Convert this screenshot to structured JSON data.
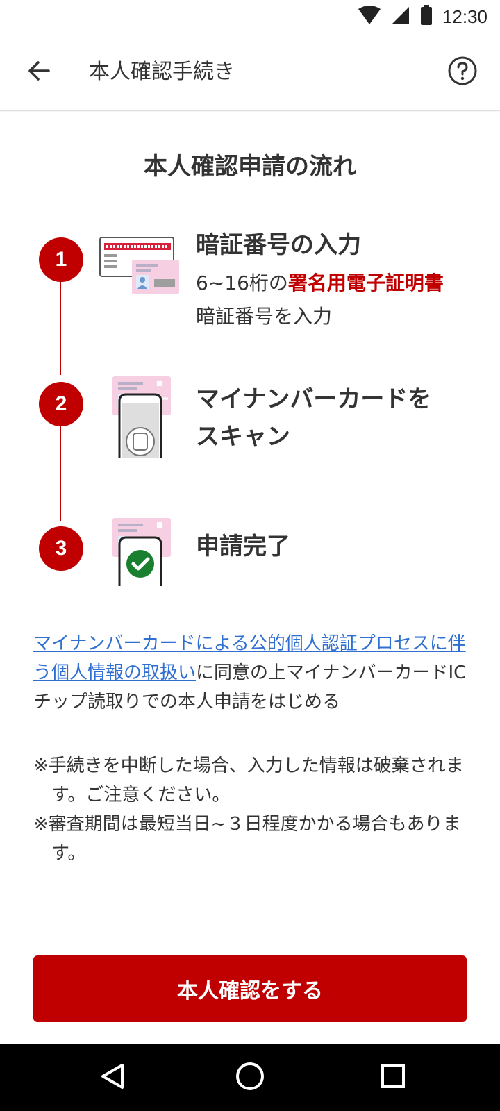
{
  "status_bar": {
    "time": "12:30"
  },
  "app_bar": {
    "title": "本人確認手続き"
  },
  "section_title": "本人確認申請の流れ",
  "steps": [
    {
      "number": "1",
      "title": "暗証番号の入力",
      "desc_prefix": "6~16桁の",
      "desc_emphasis": "署名用電子証明書",
      "desc_suffix": "暗証番号を入力"
    },
    {
      "number": "2",
      "title_line1": "マイナンバーカードを",
      "title_line2": "スキャン"
    },
    {
      "number": "3",
      "title": "申請完了"
    }
  ],
  "consent": {
    "link_text": "マイナンバーカードによる公的個人認証プロセスに伴う個人情報の取扱い",
    "text": "に同意の上マイナンバーカードICチップ読取りでの本人申請をはじめる"
  },
  "notes": [
    "※手続きを中断した場合、入力した情報は破棄されます。ご注意ください。",
    "※審査期間は最短当日~３日程度かかる場合もあります。"
  ],
  "primary_button": {
    "label": "本人確認をする"
  },
  "colors": {
    "accent": "#c00000",
    "link": "#2f6fd1",
    "success": "#1a7f2e"
  }
}
